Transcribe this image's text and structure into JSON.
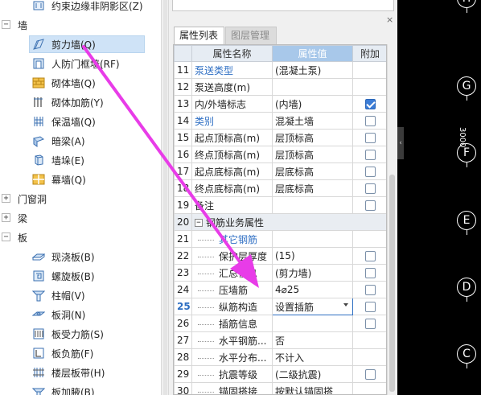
{
  "tree": {
    "top_partial": "约束边缘非阴影区(Z)",
    "categories": [
      {
        "label": "墙",
        "expanded": true
      },
      {
        "label": "门窗洞",
        "expanded": false
      },
      {
        "label": "梁",
        "expanded": false
      },
      {
        "label": "板",
        "expanded": true
      }
    ],
    "wall_items": [
      {
        "label": "剪力墙(Q)",
        "icon": "shear-wall-icon",
        "selected": true
      },
      {
        "label": "人防门框墙(RF)",
        "icon": "civil-defense-door-wall-icon"
      },
      {
        "label": "砌体墙(Q)",
        "icon": "masonry-wall-icon"
      },
      {
        "label": "砌体加筋(Y)",
        "icon": "masonry-reinforcement-icon"
      },
      {
        "label": "保温墙(Q)",
        "icon": "insulation-wall-icon"
      },
      {
        "label": "暗梁(A)",
        "icon": "hidden-beam-icon"
      },
      {
        "label": "墙垛(E)",
        "icon": "wall-pier-icon"
      },
      {
        "label": "幕墙(Q)",
        "icon": "curtain-wall-icon"
      }
    ],
    "slab_items": [
      {
        "label": "现浇板(B)",
        "icon": "cast-slab-icon"
      },
      {
        "label": "螺旋板(B)",
        "icon": "spiral-slab-icon"
      },
      {
        "label": "柱帽(V)",
        "icon": "column-cap-icon"
      },
      {
        "label": "板洞(N)",
        "icon": "slab-hole-icon"
      },
      {
        "label": "板受力筋(S)",
        "icon": "slab-main-rebar-icon"
      },
      {
        "label": "板负筋(F)",
        "icon": "slab-negative-rebar-icon"
      },
      {
        "label": "楼层板带(H)",
        "icon": "floor-slab-strip-icon"
      },
      {
        "label": "板加腋(B)",
        "icon": "slab-haunch-icon"
      }
    ]
  },
  "panel": {
    "close": "×",
    "tabs": [
      "属性列表",
      "图层管理"
    ],
    "headers": {
      "name": "属性名称",
      "value": "属性值",
      "extra": "附加"
    },
    "rows": [
      {
        "num": "11",
        "name": "泵送类型",
        "value": "(混凝土泵)",
        "blue": true,
        "check": "none"
      },
      {
        "num": "12",
        "name": "泵送高度(m)",
        "value": "",
        "check": "none"
      },
      {
        "num": "13",
        "name": "内/外墙标志",
        "value": "(内墙)",
        "check": "checked"
      },
      {
        "num": "14",
        "name": "类别",
        "value": "混凝土墙",
        "blue": true,
        "check": "unchecked"
      },
      {
        "num": "15",
        "name": "起点顶标高(m)",
        "value": "层顶标高",
        "check": "unchecked"
      },
      {
        "num": "16",
        "name": "终点顶标高(m)",
        "value": "层顶标高",
        "check": "unchecked"
      },
      {
        "num": "17",
        "name": "起点底标高(m)",
        "value": "层底标高",
        "check": "unchecked"
      },
      {
        "num": "18",
        "name": "终点底标高(m)",
        "value": "层底标高",
        "check": "unchecked"
      },
      {
        "num": "19",
        "name": "备注",
        "value": "",
        "check": "unchecked"
      },
      {
        "num": "20",
        "name": "钢筋业务属性",
        "value": "",
        "group": true,
        "check": "none"
      },
      {
        "num": "21",
        "name": "其它钢筋",
        "value": "",
        "blue": true,
        "indent": true,
        "check": "none"
      },
      {
        "num": "22",
        "name": "保护层厚度",
        "value": "(15)",
        "indent": true,
        "check": "unchecked"
      },
      {
        "num": "23",
        "name": "汇总信息",
        "value": "(剪力墙)",
        "indent": true,
        "check": "unchecked"
      },
      {
        "num": "24",
        "name": "压墙筋",
        "value": "4⌀25",
        "indent": true,
        "check": "unchecked"
      },
      {
        "num": "25",
        "name": "纵筋构造",
        "value": "设置插筋",
        "indent": true,
        "current": true,
        "dropdown": true,
        "check": "unchecked"
      },
      {
        "num": "26",
        "name": "插筋信息",
        "value": "",
        "indent": true,
        "check": "unchecked"
      },
      {
        "num": "27",
        "name": "水平钢筋...",
        "value": "否",
        "indent": true,
        "check": "none"
      },
      {
        "num": "28",
        "name": "水平分布...",
        "value": "不计入",
        "indent": true,
        "check": "none"
      },
      {
        "num": "29",
        "name": "抗震等级",
        "value": "(二级抗震)",
        "indent": true,
        "check": "unchecked"
      },
      {
        "num": "30",
        "name": "锚固搭接",
        "value": "按默认锚固搭",
        "indent": true,
        "check": "none"
      }
    ]
  },
  "canvas": {
    "axis_labels": [
      "H",
      "G",
      "F",
      "E",
      "D",
      "C"
    ],
    "vertical_text": "3000",
    "collapse_glyph": "‹",
    "colors": {
      "background": "#000000",
      "axis": "#ffffff",
      "arrow": "#e83ce8"
    }
  }
}
